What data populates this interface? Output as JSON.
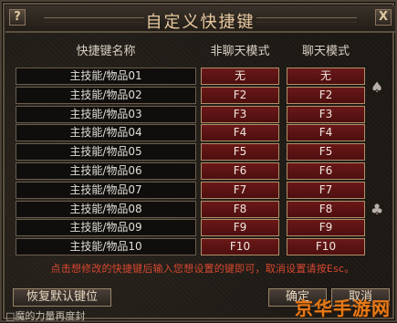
{
  "window": {
    "title": "自定义快捷键",
    "help_label": "?",
    "close_label": "X"
  },
  "headers": {
    "name": "快捷键名称",
    "non_chat": "非聊天模式",
    "chat": "聊天模式"
  },
  "rows": [
    {
      "name": "主技能/物品01",
      "non_chat": "无",
      "chat": "无"
    },
    {
      "name": "主技能/物品02",
      "non_chat": "F2",
      "chat": "F2"
    },
    {
      "name": "主技能/物品03",
      "non_chat": "F3",
      "chat": "F3"
    },
    {
      "name": "主技能/物品04",
      "non_chat": "F4",
      "chat": "F4"
    },
    {
      "name": "主技能/物品05",
      "non_chat": "F5",
      "chat": "F5"
    },
    {
      "name": "主技能/物品06",
      "non_chat": "F6",
      "chat": "F6"
    },
    {
      "name": "主技能/物品07",
      "non_chat": "F7",
      "chat": "F7"
    },
    {
      "name": "主技能/物品08",
      "non_chat": "F8",
      "chat": "F8"
    },
    {
      "name": "主技能/物品09",
      "non_chat": "F9",
      "chat": "F9"
    },
    {
      "name": "主技能/物品10",
      "non_chat": "F10",
      "chat": "F10"
    }
  ],
  "side_ornaments": [
    "♠",
    "♣"
  ],
  "hint": "点击想修改的快捷键后输入您想设置的键即可，取消设置请按Esc。",
  "buttons": {
    "reset": "恢复默认键位",
    "ok": "确定",
    "cancel": "取消"
  },
  "bottom_text": "□魔的力量再度封",
  "watermark": "京华手游网",
  "colors": {
    "title": "#e8c8a0",
    "key_cell_bg": "#5a1414",
    "hint": "#d84830",
    "watermark": "#e87a18"
  }
}
